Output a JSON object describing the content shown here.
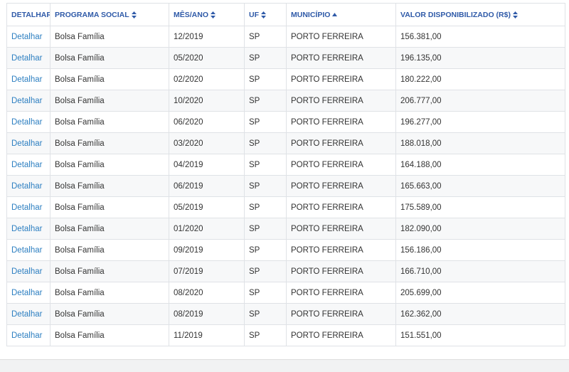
{
  "columns": [
    {
      "label": "DETALHAR",
      "sort": "none"
    },
    {
      "label": "PROGRAMA SOCIAL",
      "sort": "both"
    },
    {
      "label": "MÊS/ANO",
      "sort": "both"
    },
    {
      "label": "UF",
      "sort": "both"
    },
    {
      "label": "MUNICÍPIO",
      "sort": "asc"
    },
    {
      "label": "VALOR DISPONIBILIZADO (R$)",
      "sort": "both"
    }
  ],
  "rows": [
    {
      "detalhar": "Detalhar",
      "programa": "Bolsa Família",
      "mes_ano": "12/2019",
      "uf": "SP",
      "municipio": "PORTO FERREIRA",
      "valor": "156.381,00"
    },
    {
      "detalhar": "Detalhar",
      "programa": "Bolsa Família",
      "mes_ano": "05/2020",
      "uf": "SP",
      "municipio": "PORTO FERREIRA",
      "valor": "196.135,00"
    },
    {
      "detalhar": "Detalhar",
      "programa": "Bolsa Família",
      "mes_ano": "02/2020",
      "uf": "SP",
      "municipio": "PORTO FERREIRA",
      "valor": "180.222,00"
    },
    {
      "detalhar": "Detalhar",
      "programa": "Bolsa Família",
      "mes_ano": "10/2020",
      "uf": "SP",
      "municipio": "PORTO FERREIRA",
      "valor": "206.777,00"
    },
    {
      "detalhar": "Detalhar",
      "programa": "Bolsa Família",
      "mes_ano": "06/2020",
      "uf": "SP",
      "municipio": "PORTO FERREIRA",
      "valor": "196.277,00"
    },
    {
      "detalhar": "Detalhar",
      "programa": "Bolsa Família",
      "mes_ano": "03/2020",
      "uf": "SP",
      "municipio": "PORTO FERREIRA",
      "valor": "188.018,00"
    },
    {
      "detalhar": "Detalhar",
      "programa": "Bolsa Família",
      "mes_ano": "04/2019",
      "uf": "SP",
      "municipio": "PORTO FERREIRA",
      "valor": "164.188,00"
    },
    {
      "detalhar": "Detalhar",
      "programa": "Bolsa Família",
      "mes_ano": "06/2019",
      "uf": "SP",
      "municipio": "PORTO FERREIRA",
      "valor": "165.663,00"
    },
    {
      "detalhar": "Detalhar",
      "programa": "Bolsa Família",
      "mes_ano": "05/2019",
      "uf": "SP",
      "municipio": "PORTO FERREIRA",
      "valor": "175.589,00"
    },
    {
      "detalhar": "Detalhar",
      "programa": "Bolsa Família",
      "mes_ano": "01/2020",
      "uf": "SP",
      "municipio": "PORTO FERREIRA",
      "valor": "182.090,00"
    },
    {
      "detalhar": "Detalhar",
      "programa": "Bolsa Família",
      "mes_ano": "09/2019",
      "uf": "SP",
      "municipio": "PORTO FERREIRA",
      "valor": "156.186,00"
    },
    {
      "detalhar": "Detalhar",
      "programa": "Bolsa Família",
      "mes_ano": "07/2019",
      "uf": "SP",
      "municipio": "PORTO FERREIRA",
      "valor": "166.710,00"
    },
    {
      "detalhar": "Detalhar",
      "programa": "Bolsa Família",
      "mes_ano": "08/2020",
      "uf": "SP",
      "municipio": "PORTO FERREIRA",
      "valor": "205.699,00"
    },
    {
      "detalhar": "Detalhar",
      "programa": "Bolsa Família",
      "mes_ano": "08/2019",
      "uf": "SP",
      "municipio": "PORTO FERREIRA",
      "valor": "162.362,00"
    },
    {
      "detalhar": "Detalhar",
      "programa": "Bolsa Família",
      "mes_ano": "11/2019",
      "uf": "SP",
      "municipio": "PORTO FERREIRA",
      "valor": "151.551,00"
    }
  ],
  "colors": {
    "header_text": "#2f5aa8",
    "link": "#2d7fc1",
    "text": "#333333",
    "stripe": "#f7f8f9",
    "border": "#dfe2e6"
  },
  "icons": {
    "sort_both": "sort-both-icon",
    "sort_asc": "sort-asc-icon"
  }
}
